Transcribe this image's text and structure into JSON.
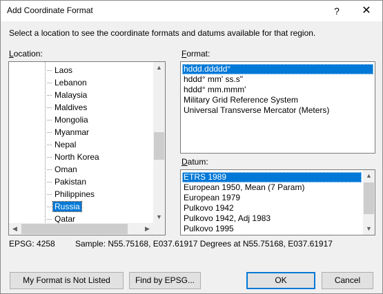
{
  "dialog": {
    "title": "Add Coordinate Format",
    "help": "?",
    "close": "✕",
    "instructions": "Select a location to see the coordinate formats and datums available for that region."
  },
  "location": {
    "label_first": "L",
    "label_rest": "ocation:",
    "items": [
      "Laos",
      "Lebanon",
      "Malaysia",
      "Maldives",
      "Mongolia",
      "Myanmar",
      "Nepal",
      "North Korea",
      "Oman",
      "Pakistan",
      "Philippines",
      "Russia",
      "Qatar"
    ],
    "selected": "Russia"
  },
  "format": {
    "label_first": "F",
    "label_rest": "ormat:",
    "items": [
      "hddd.ddddd°",
      "hddd° mm' ss.s\"",
      "hddd° mm.mmm'",
      "Military Grid Reference System",
      "Universal Transverse Mercator (Meters)"
    ],
    "selected": "hddd.ddddd°"
  },
  "datum": {
    "label_first": "D",
    "label_rest": "atum:",
    "items": [
      "ETRS 1989",
      "European 1950, Mean (7 Param)",
      "European 1979",
      "Pulkovo 1942",
      "Pulkovo 1942, Adj 1983",
      "Pulkovo 1995"
    ],
    "selected": "ETRS 1989"
  },
  "status": {
    "epsg": "EPSG: 4258",
    "sample": "Sample: N55.75168, E037.61917 Degrees at N55.75168, E037.61917"
  },
  "buttons": {
    "not_listed": "My Format is Not Listed",
    "find_epsg": "Find by EPSG...",
    "ok": "OK",
    "cancel": "Cancel"
  },
  "icons": {
    "arrow_up": "▲",
    "arrow_down": "▼",
    "arrow_left": "◀",
    "arrow_right": "▶"
  }
}
